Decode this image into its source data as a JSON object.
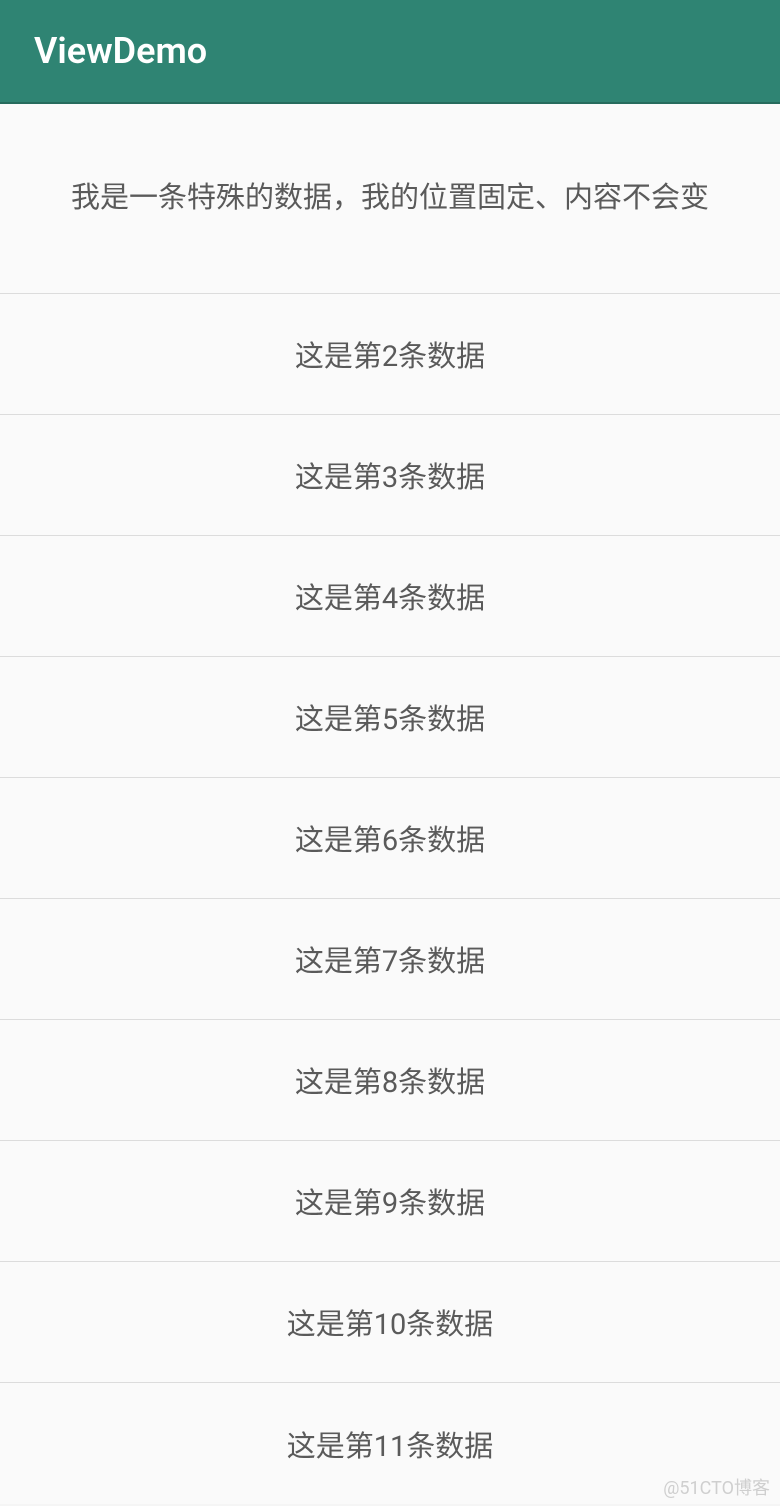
{
  "actionBar": {
    "title": "ViewDemo"
  },
  "header": {
    "text": "我是一条特殊的数据，我的位置固定、内容不会变"
  },
  "listItems": [
    {
      "text": "这是第2条数据"
    },
    {
      "text": "这是第3条数据"
    },
    {
      "text": "这是第4条数据"
    },
    {
      "text": "这是第5条数据"
    },
    {
      "text": "这是第6条数据"
    },
    {
      "text": "这是第7条数据"
    },
    {
      "text": "这是第8条数据"
    },
    {
      "text": "这是第9条数据"
    },
    {
      "text": "这是第10条数据"
    },
    {
      "text": "这是第11条数据"
    }
  ],
  "watermark": "@51CTO博客"
}
